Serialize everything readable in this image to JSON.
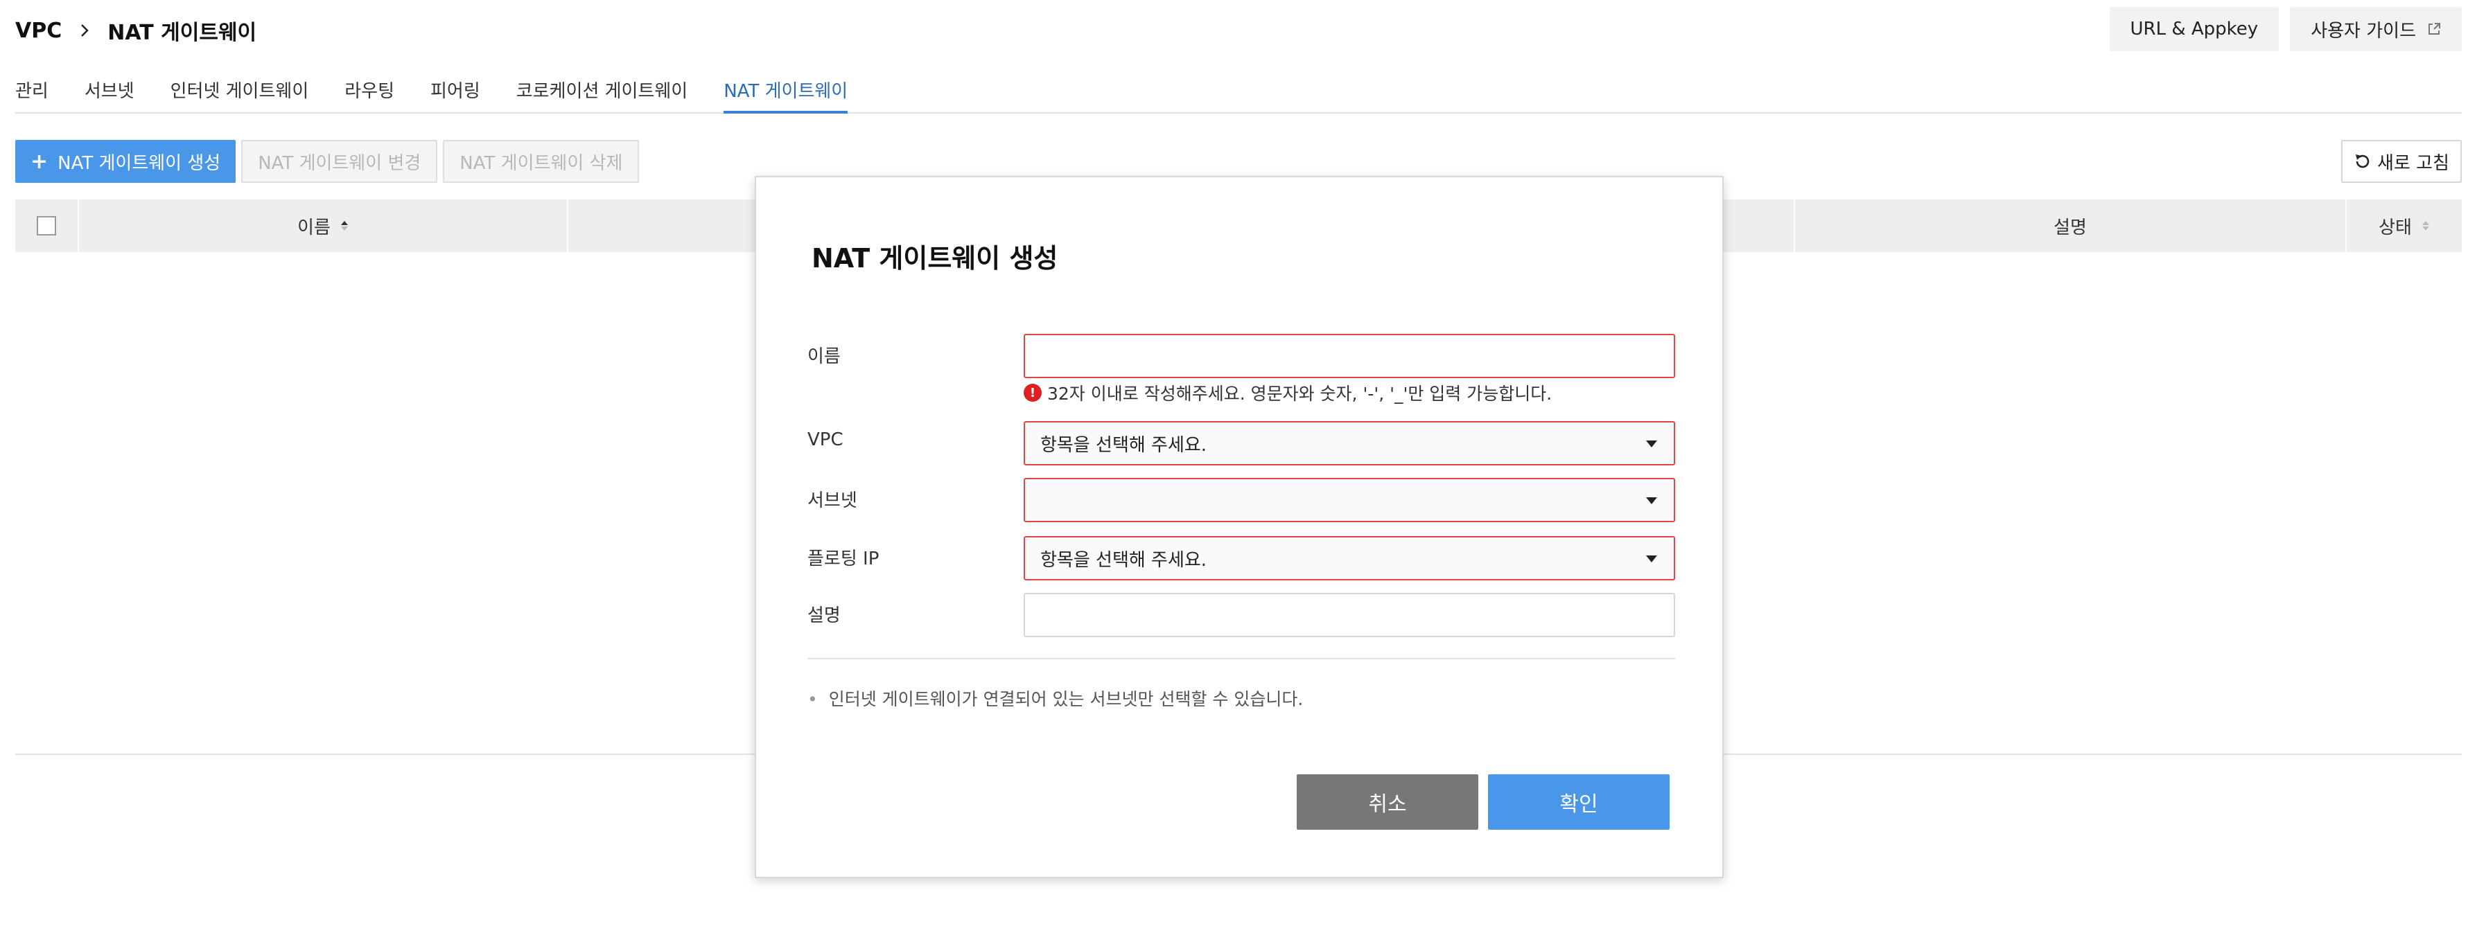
{
  "breadcrumb": {
    "root": "VPC",
    "current": "NAT 게이트웨이"
  },
  "header_buttons": {
    "url_appkey": "URL & Appkey",
    "user_guide": "사용자 가이드"
  },
  "tabs": [
    {
      "label": "관리",
      "active": false
    },
    {
      "label": "서브넷",
      "active": false
    },
    {
      "label": "인터넷 게이트웨이",
      "active": false
    },
    {
      "label": "라우팅",
      "active": false
    },
    {
      "label": "피어링",
      "active": false
    },
    {
      "label": "코로케이션 게이트웨이",
      "active": false
    },
    {
      "label": "NAT 게이트웨이",
      "active": true
    }
  ],
  "toolbar": {
    "create": "NAT 게이트웨이 생성",
    "modify": "NAT 게이트웨이 변경",
    "delete": "NAT 게이트웨이 삭제",
    "refresh": "새로 고침"
  },
  "table": {
    "columns": [
      "이름",
      "설명",
      "상태"
    ]
  },
  "modal": {
    "title": "NAT 게이트웨이 생성",
    "fields": {
      "name": {
        "label": "이름",
        "value": ""
      },
      "name_error": "32자 이내로 작성해주세요. 영문자와 숫자, '-', '_'만 입력 가능합니다.",
      "vpc": {
        "label": "VPC",
        "value": "항목을 선택해 주세요."
      },
      "subnet": {
        "label": "서브넷",
        "value": ""
      },
      "floating_ip": {
        "label": "플로팅 IP",
        "value": "항목을 선택해 주세요."
      },
      "description": {
        "label": "설명",
        "value": ""
      }
    },
    "note": "인터넷 게이트웨이가 연결되어 있는 서브넷만 선택할 수 있습니다.",
    "cancel": "취소",
    "confirm": "확인"
  },
  "colors": {
    "primary": "#4a96e8",
    "error": "#e64545",
    "tab_active": "#3b82d6"
  }
}
